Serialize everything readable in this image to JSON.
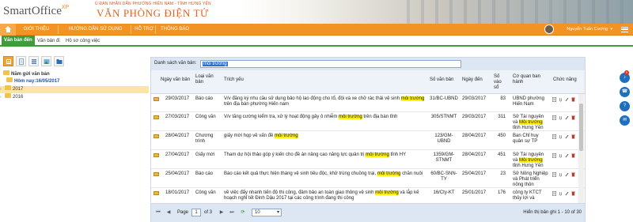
{
  "header": {
    "logo_main": "SmartOffice",
    "logo_sup": "XP",
    "org_line": "Ủ ĐÀN NHÂN DÂN PHƯỜNG HIẾN NAM - TỈNH HƯNG YÊN",
    "org_title": "VĂN PHÒNG ĐIỆN TỬ"
  },
  "nav": {
    "items": [
      "GIỚI THIỆU",
      "HƯỚNG DẪN SỬ DỤNG",
      "HỖ TRỢ",
      "THÔNG BÁO"
    ],
    "user_name": "Nguyễn Tuấn Cường",
    "user_caret": "▾"
  },
  "tabs": [
    "Văn bản đến",
    "Văn bản đi",
    "Hồ sơ công việc"
  ],
  "tree": {
    "root": "Năm gửi văn bản",
    "today": "Hôm nay:16/05/2017",
    "years": [
      "2017",
      "2016"
    ]
  },
  "search": {
    "label": "Danh sách văn bản:",
    "value": "môi trường"
  },
  "table": {
    "headers": {
      "ngay_van_ban": "Ngày văn bản",
      "loai_van_ban": "Loại văn bản",
      "trich_yeu": "Trích yếu",
      "so_van_ban": "Số văn bản",
      "ngay_den": "Ngày đến",
      "so_vao_so": "Số vào sổ",
      "co_quan": "Cơ quan ban hành",
      "chuc_nang": "Chức năng"
    },
    "rows": [
      {
        "ngay": "29/03/2017",
        "loai": "Báo cáo",
        "trich_pre": "V/v đăng ký nhu cầu sử dụng bảo hộ lao động cho tổ, đội và xe chở rác thải vệ sinh ",
        "trich_hl": "môi trường",
        "trich_post": " trên địa bàn phường Hiến nam",
        "so": "31/BC-UBND",
        "den": "29/03/2017",
        "vao": "83",
        "cq_pre": "UBND phường Hiến Nam",
        "cq_hl": "",
        "cq_post": ""
      },
      {
        "ngay": "27/03/2017",
        "loai": "Công văn",
        "trich_pre": "V/v tăng cường kiểm tra, xử lý hoạt động gây ô nhiễm ",
        "trich_hl": "môi trường",
        "trich_post": " trên địa bàn tỉnh",
        "so": "305/STNMT",
        "den": "29/03/2017",
        "vao": "311",
        "cq_pre": "Sở Tài nguyên và ",
        "cq_hl": "Môi trường",
        "cq_post": " tỉnh Hưng Yên"
      },
      {
        "ngay": "28/04/2017",
        "loai": "Chương trình",
        "trich_pre": "giấy mời họp về vấn đề ",
        "trich_hl": "môi trường",
        "trich_post": "",
        "so": "123/GM-UBND",
        "den": "28/04/2017",
        "vao": "450",
        "cq_pre": "Ban Chỉ huy quân sự TP",
        "cq_hl": "",
        "cq_post": ""
      },
      {
        "ngay": "27/04/2017",
        "loai": "Giấy mời",
        "trich_pre": "Tham dự hội thảo góp ý kiến cho đề án nâng cao năng lực quản trị ",
        "trich_hl": "môi trường",
        "trich_post": " tỉnh HY",
        "so": "1359/GM-STNMT",
        "den": "28/04/2017",
        "vao": "451",
        "cq_pre": "Sở Tài nguyên và ",
        "cq_hl": "Môi trường",
        "cq_post": " tỉnh Hưng Yên"
      },
      {
        "ngay": "25/04/2017",
        "loai": "Báo cáo",
        "trich_pre": "Báo cáo kết quả thực hiện tháng vệ sinh tiêu độc, khử trùng chuồng trại, ",
        "trich_hl": "môi trường",
        "trich_post": " chăn nuôi",
        "so": "60/BC-SNN-TY",
        "den": "25/04/2017",
        "vao": "23",
        "cq_pre": "Sở Nông Nghiệp và Phát triển nông thôn",
        "cq_hl": "",
        "cq_post": ""
      },
      {
        "ngay": "18/01/2017",
        "loai": "Công văn",
        "trich_pre": "về việc đẩy nhanh tiến độ thi công, đảm bảo an toàn giao thông vệ sinh ",
        "trich_hl": "môi trường",
        "trich_post": " và lắp kế hoạch nghỉ tết Đinh Dậu 2017 tại các công trình đang thi công",
        "so": "16/Cty-KT",
        "den": "25/01/2017",
        "vao": "176",
        "cq_pre": "công ty KTCT thủy lợi và",
        "cq_hl": "",
        "cq_post": ""
      }
    ]
  },
  "pager": {
    "page_label": "Page",
    "page_value": "1",
    "of_label": "of 3",
    "page_size": "10",
    "info": "Hiển thị bản ghi 1 - 10 of 30",
    "first": "⏮",
    "prev": "◀",
    "next": "▶",
    "last": "⏭",
    "refresh": "⟳"
  },
  "fab_badge": "0"
}
